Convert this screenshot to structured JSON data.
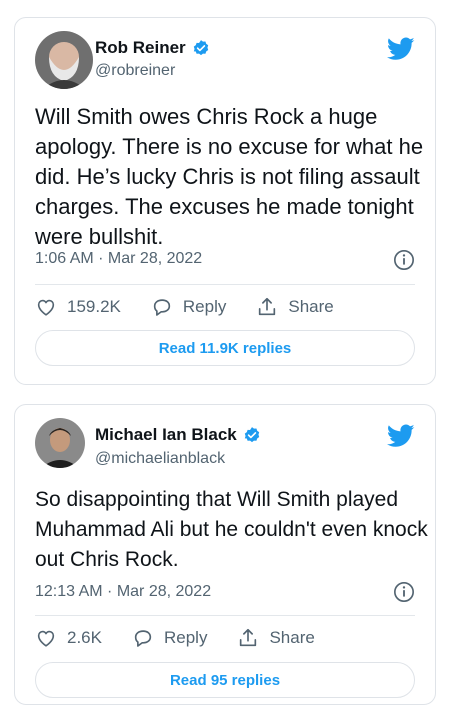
{
  "tweets": [
    {
      "author": "Rob Reiner",
      "handle": "@robreiner",
      "text": "Will Smith owes Chris Rock a huge apology. There is no excuse for what he did. He’s lucky Chris is not filing assault charges. The excuses he made tonight were bullshit.",
      "timestamp": "1:06 AM · Mar 28, 2022",
      "likes": "159.2K",
      "reply_label": "Reply",
      "share_label": "Share",
      "read_replies": "Read 11.9K replies"
    },
    {
      "author": "Michael Ian Black",
      "handle": "@michaelianblack",
      "text": "So disappointing that Will Smith played Muhammad Ali but he couldn't even knock out Chris Rock.",
      "timestamp": "12:13 AM · Mar 28, 2022",
      "likes": "2.6K",
      "reply_label": "Reply",
      "share_label": "Share",
      "read_replies": "Read 95 replies"
    }
  ],
  "colors": {
    "brand_blue": "#1d9bf0",
    "text_primary": "#0f1419",
    "text_secondary": "#536471",
    "border": "#dfe3e8"
  },
  "icons": [
    "verified-badge-icon",
    "twitter-bird-icon",
    "info-icon",
    "heart-icon",
    "reply-bubble-icon",
    "share-icon"
  ]
}
